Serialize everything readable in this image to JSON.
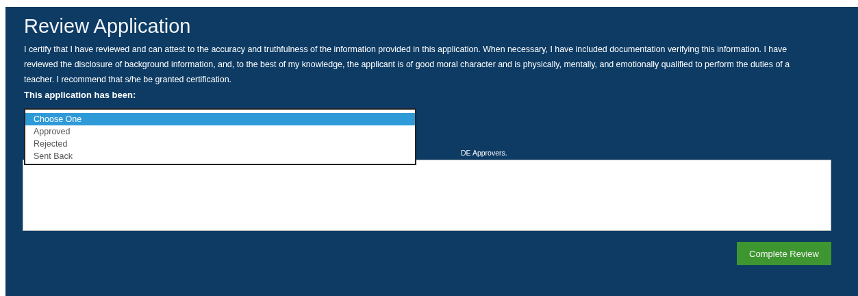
{
  "panel": {
    "title": "Review Application",
    "statement": "I certify that I have reviewed and can attest to the accuracy and truthfulness of the information provided in this application. When necessary, I have included documentation verifying this information. I have reviewed the disclosure of background information, and, to the best of my knowledge, the applicant is of good moral character and is physically, mentally, and emotionally qualified to perform the duties of a teacher. I recommend that s/he be granted certification.",
    "status_label": "This application has been:",
    "status_dropdown": {
      "expanded": true,
      "options": [
        {
          "label": "Choose One",
          "selected": true
        },
        {
          "label": "Approved",
          "selected": false
        },
        {
          "label": "Rejected",
          "selected": false
        },
        {
          "label": "Sent Back",
          "selected": false
        }
      ]
    },
    "comment_hint": "DE Approvers.",
    "buttons": [
      {
        "label": "Complete Review"
      }
    ]
  }
}
